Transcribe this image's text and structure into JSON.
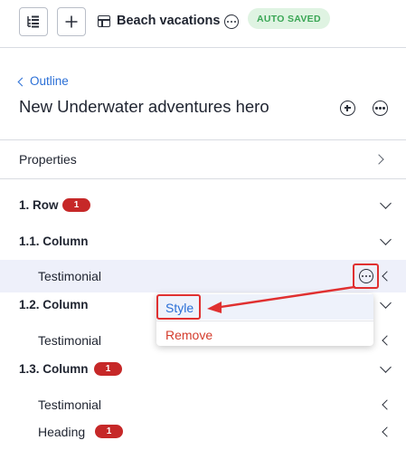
{
  "toolbar": {
    "document_title": "Beach vacations",
    "status_badge": "AUTO SAVED"
  },
  "header": {
    "back_link": "Outline",
    "title": "New Underwater adventures hero"
  },
  "properties": {
    "label": "Properties"
  },
  "tree": [
    {
      "label": "1. Row",
      "level": 0,
      "badge": "1"
    },
    {
      "label": "1.1. Column",
      "level": 0
    },
    {
      "label": "Testimonial",
      "level": 1,
      "selected": true
    },
    {
      "label": "1.2. Column",
      "level": 0
    },
    {
      "label": "Testimonial",
      "level": 1
    },
    {
      "label": "1.3. Column",
      "level": 0,
      "badge": "1"
    },
    {
      "label": "Testimonial",
      "level": 1
    },
    {
      "label": "Heading",
      "level": 1,
      "badge": "1"
    }
  ],
  "context_menu": {
    "items": [
      {
        "label": "Style"
      },
      {
        "label": "Remove"
      }
    ]
  },
  "colors": {
    "accent_blue": "#2a6fd6",
    "annotation_red": "#e03030",
    "badge_red": "#c62828",
    "saved_green": "#3aa655"
  }
}
